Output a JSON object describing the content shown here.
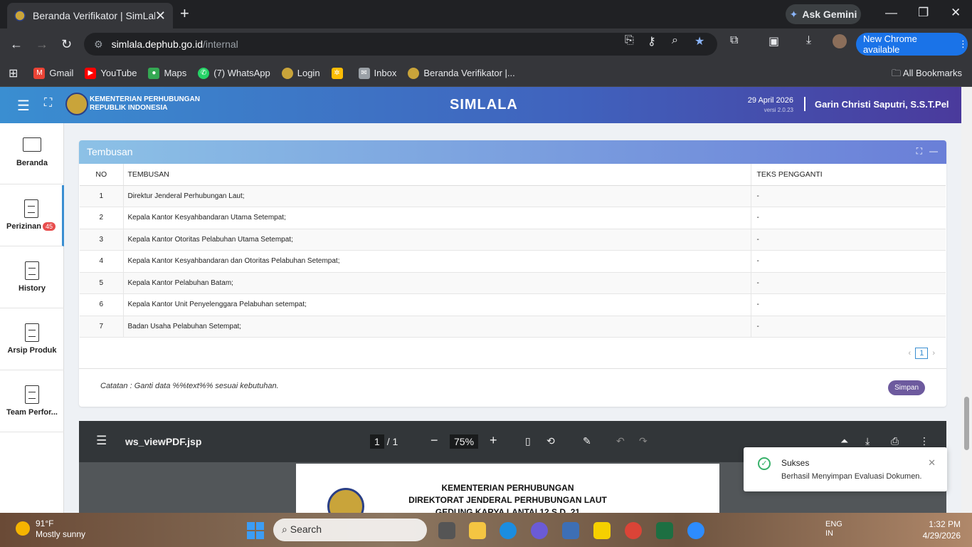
{
  "browser": {
    "tab_title": "Beranda Verifikator | SimLala",
    "tab_close": "✕",
    "new_tab": "+",
    "ask_gemini": "Ask Gemini",
    "url_host": "simlala.dephub.go.id",
    "url_path": "/internal",
    "new_chrome": "New Chrome available",
    "bookmarks": [
      {
        "label": "Gmail",
        "color": "#ea4335"
      },
      {
        "label": "YouTube",
        "color": "#ff0000"
      },
      {
        "label": "Maps",
        "color": "#34a853"
      },
      {
        "label": "(7) WhatsApp",
        "color": "#25d366"
      },
      {
        "label": "Login",
        "color": "#c9a43a"
      },
      {
        "label": "",
        "color": "#fbbc04"
      },
      {
        "label": "Inbox",
        "color": "#9aa0a6"
      },
      {
        "label": "Beranda Verifikator |...",
        "color": "#c9a43a"
      }
    ],
    "all_bookmarks": "All Bookmarks"
  },
  "app": {
    "org_line1": "KEMENTERIAN PERHUBUNGAN",
    "org_line2": "REPUBLIK INDONESIA",
    "title": "SIMLALA",
    "date": "29 April 2026",
    "version": "versi 2.0.23",
    "user": "Garin Christi Saputri, S.S.T.Pel"
  },
  "sidebar": {
    "items": [
      {
        "label": "Beranda"
      },
      {
        "label": "Perizinan",
        "badge": "45"
      },
      {
        "label": "History"
      },
      {
        "label": "Arsip Produk"
      },
      {
        "label": "Team Perfor..."
      }
    ]
  },
  "card": {
    "title": "Tembusan",
    "columns": [
      "NO",
      "TEMBUSAN",
      "TEKS PENGGANTI"
    ],
    "rows": [
      [
        "1",
        "Direktur Jenderal Perhubungan Laut;",
        "-"
      ],
      [
        "2",
        "Kepala Kantor Kesyahbandaran Utama Setempat;",
        "-"
      ],
      [
        "3",
        "Kepala Kantor Otoritas Pelabuhan Utama Setempat;",
        "-"
      ],
      [
        "4",
        "Kepala Kantor Kesyahbandaran dan Otoritas Pelabuhan Setempat;",
        "-"
      ],
      [
        "5",
        "Kepala Kantor Pelabuhan Batam;",
        "-"
      ],
      [
        "6",
        "Kepala Kantor Unit Penyelenggara Pelabuhan setempat;",
        "-"
      ],
      [
        "7",
        "Badan Usaha Pelabuhan Setempat;",
        "-"
      ]
    ],
    "page": "1",
    "note": "Catatan : Ganti data %%text%% sesuai kebutuhan.",
    "save_label": "Simpan"
  },
  "pdf": {
    "filename": "ws_viewPDF.jsp",
    "page_current": "1",
    "page_total": "/ 1",
    "zoom": "75%",
    "line1": "KEMENTERIAN PERHUBUNGAN",
    "line2": "DIREKTORAT JENDERAL PERHUBUNGAN LAUT",
    "line3": "GEDUNG KARYA LANTAI 12 S.D. 21"
  },
  "toast": {
    "title": "Sukses",
    "message": "Berhasil Menyimpan Evaluasi Dokumen."
  },
  "taskbar": {
    "temp": "91°F",
    "weather": "Mostly sunny",
    "search": "Search",
    "lang1": "ENG",
    "lang2": "IN",
    "time": "1:32 PM",
    "date": "4/29/2026"
  }
}
